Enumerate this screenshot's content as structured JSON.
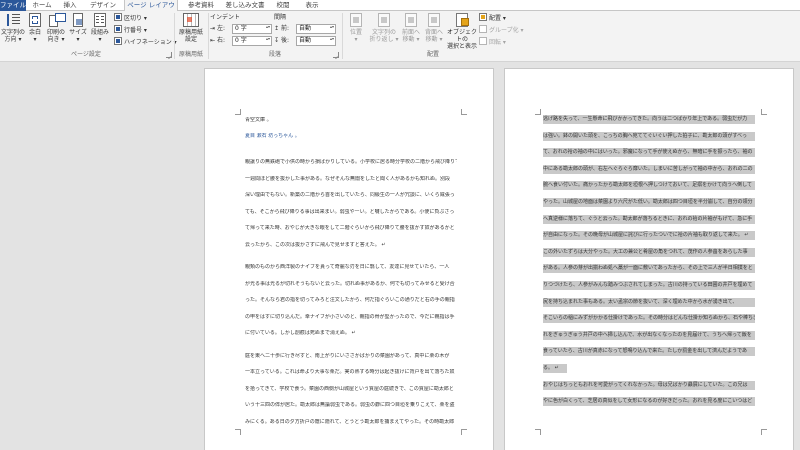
{
  "tabs": [
    {
      "label": "ファイル",
      "kind": "file"
    },
    {
      "label": "ホーム",
      "kind": "normal"
    },
    {
      "label": "挿入",
      "kind": "normal"
    },
    {
      "label": "デザイン",
      "kind": "normal"
    },
    {
      "label": "ページ レイアウト",
      "kind": "active"
    },
    {
      "label": "参考資料",
      "kind": "normal"
    },
    {
      "label": "差し込み文書",
      "kind": "normal"
    },
    {
      "label": "校閲",
      "kind": "normal"
    },
    {
      "label": "表示",
      "kind": "normal"
    }
  ],
  "ribbon": {
    "page_setup": {
      "group_label": "ページ設定",
      "text_direction": {
        "line1": "文字列の",
        "line2": "方向 ▾"
      },
      "margins": {
        "line1": "余白",
        "line2": "▾"
      },
      "orientation": {
        "line1": "印刷の",
        "line2": "向き ▾"
      },
      "size": {
        "line1": "サイズ",
        "line2": "▾"
      },
      "columns": {
        "line1": "段組み",
        "line2": "▾"
      },
      "breaks": "区切り ▾",
      "line_numbers": "行番号 ▾",
      "hyphenation": "ハイフネーション ▾"
    },
    "manuscript": {
      "group_label": "原稿用紙",
      "button": {
        "line1": "原稿用紙",
        "line2": "設定"
      }
    },
    "paragraph": {
      "group_label": "段落",
      "indent_header": "インデント",
      "spacing_header": "間隔",
      "left_label": "左:",
      "left_value": "0 字",
      "right_label": "右:",
      "right_value": "0 字",
      "before_label": "前:",
      "before_value": "自動",
      "after_label": "後:",
      "after_value": "自動"
    },
    "arrange": {
      "group_label": "配置",
      "position": {
        "line1": "位置",
        "line2": "▾"
      },
      "wrap_text": {
        "line1": "文字列の",
        "line2": "折り返し ▾"
      },
      "bring_forward": {
        "line1": "前面へ",
        "line2": "移動 ▾"
      },
      "send_backward": {
        "line1": "背面へ",
        "line2": "移動 ▾"
      },
      "selection_pane": {
        "line1": "オブジェクトの",
        "line2": "選択と表示"
      },
      "align": "配置 ▾",
      "group": "グループ化 ▾",
      "rotate": "回転 ▾"
    }
  },
  "document": {
    "page1_lines": [
      {
        "text": "青空文庫 。",
        "kind": "title"
      },
      {
        "text": "夏目 漱石 坊っちゃん 。",
        "kind": "author"
      },
      {
        "text": "親譲りの無鉄砲で小供の時から損ばかりしている。小学校に居る時分学校の二階から飛び降りて",
        "kind": "body"
      },
      {
        "text": "一週間ほど腰を抜かした事がある。なぜそんな無闇をしたと聞く人があるかも知れぬ。別段",
        "kind": "body"
      },
      {
        "text": "深い理由でもない。新築の二階から首を出していたら、同級生の一人が冗談に、いくら威張っ",
        "kind": "body"
      },
      {
        "text": "ても、そこから飛び降りる事は出来まい。弱虫やーい。と囃したからである。小使に負ぶさっ",
        "kind": "body"
      },
      {
        "text": "て帰って来た時、おやじが大きな眼をして二階ぐらいから飛び降りて腰を抜かす奴があるかと",
        "kind": "body"
      },
      {
        "text": "云ったから、この次は抜かさずに飛んで見せますと答えた。 ↵",
        "kind": "body"
      },
      {
        "text": "親類のものから西洋製のナイフを貰って奇麗な刃を日に翳して、友達に見せていたら、一人",
        "kind": "body"
      },
      {
        "text": "が光る事は光るが切れそうもないと云った。切れぬ事があるか、何でも切ってみせると受け合",
        "kind": "body"
      },
      {
        "text": "った。そんなら君の指を切ってみろと注文したから、何だ指ぐらいこの通りだと右の手の親指",
        "kind": "body"
      },
      {
        "text": "の甲をはすに切り込んだ。幸ナイフが小さいのと、親指の骨が堅かったので、今だに親指は手",
        "kind": "body"
      },
      {
        "text": "に付いている。しかし創痕は死ぬまで消えぬ。 ↵",
        "kind": "body"
      },
      {
        "text": "庭を東へ二十歩に行き尽すと、南上がりにいささかばかりの菜園があって、真中に栗の木が",
        "kind": "body"
      },
      {
        "text": "一本立っている。これは命より大事な栗だ。実の熟する時分は起き抜けに背戸を出て落ちた奴",
        "kind": "body"
      },
      {
        "text": "を拾ってきて、学校で食う。菜園の西側が山城屋という質屋の庭続きで、この質屋に勘太郎と",
        "kind": "body"
      },
      {
        "text": "いう十三四の倅が居た。勘太郎は無論弱虫である。弱虫の癖に四つ目垣を乗りこえて、栗を盗",
        "kind": "body"
      },
      {
        "text": "みにくる。ある日の夕方折戸の蔭に隠れて、とうとう勘太郎を捕まえてやった。その時勘太郎",
        "kind": "body"
      }
    ],
    "page2_lines": [
      "逃げ路を失って、一生懸命に飛びかかってきた。向うは二つばかり年上である。弱虫だが力",
      "は強い。鉢の開いた頭を、こっちの胸へ宛ててぐいぐい押した拍子に、勘太郎の頭がすべっ",
      "て、おれの袷の袖の中にはいった。邪魔になって手が使えぬから、無暗に手を振ったら、袖の",
      "中にある勘太郎の頭が、右左へぐらぐら靡いた。しまいに苦しがって袖の中から、おれの二の",
      "腕へ食い付いた。痛かったから勘太郎を垣根へ押しつけておいて、足搦をかけて向うへ倒して",
      "やった。山城屋の地面は菜園より六尺がた低い。勘太郎は四つ目垣を半分崩して、自分の領分",
      "へ真逆様に落ちて、ぐうと云った。勘太郎が落ちるときに、おれの袷の片袖がもげて、急に手",
      "が自由になった。その晩母が山城屋に詫びに行ったついでに袷の片袖も取り返して来た。 ↵",
      "この外いたずらは大分やった。大工の兼公と肴屋の角をつれて、茂作の人参畠をあらした事",
      "がある。人参の芽が出揃わぬ処へ藁が一面に敷いてあったから、その上で三人が半日相撲をと",
      "りつづけたら、人参がみんな踏みつぶされてしまった。古川の持っている田圃の井戸を埋めて",
      "尻を持ち込まれた事もある。太い孟宗の節を抜いて、深く埋めた中から水が湧き出て、",
      "そこいらの稲にみずがかかる仕掛けであった。その時分はどんな仕掛か知らぬから、石や棒ちぎ",
      "れをぎゅうぎゅう井戸の中へ挿し込んで、水が出なくなったのを見届けて、うちへ帰って飯を",
      "食っていたら、古川が真赤になって怒鳴り込んで来た。たしか罰金を出して済んだようであ",
      "る。 ↵",
      "おやじはちっともおれを可愛がってくれなかった。母は兄ばかり贔屓にしていた。この兄は",
      "やに色が白くって、芝居の真似をして女形になるのが好きだった。おれを見る度にこいつはど"
    ]
  }
}
